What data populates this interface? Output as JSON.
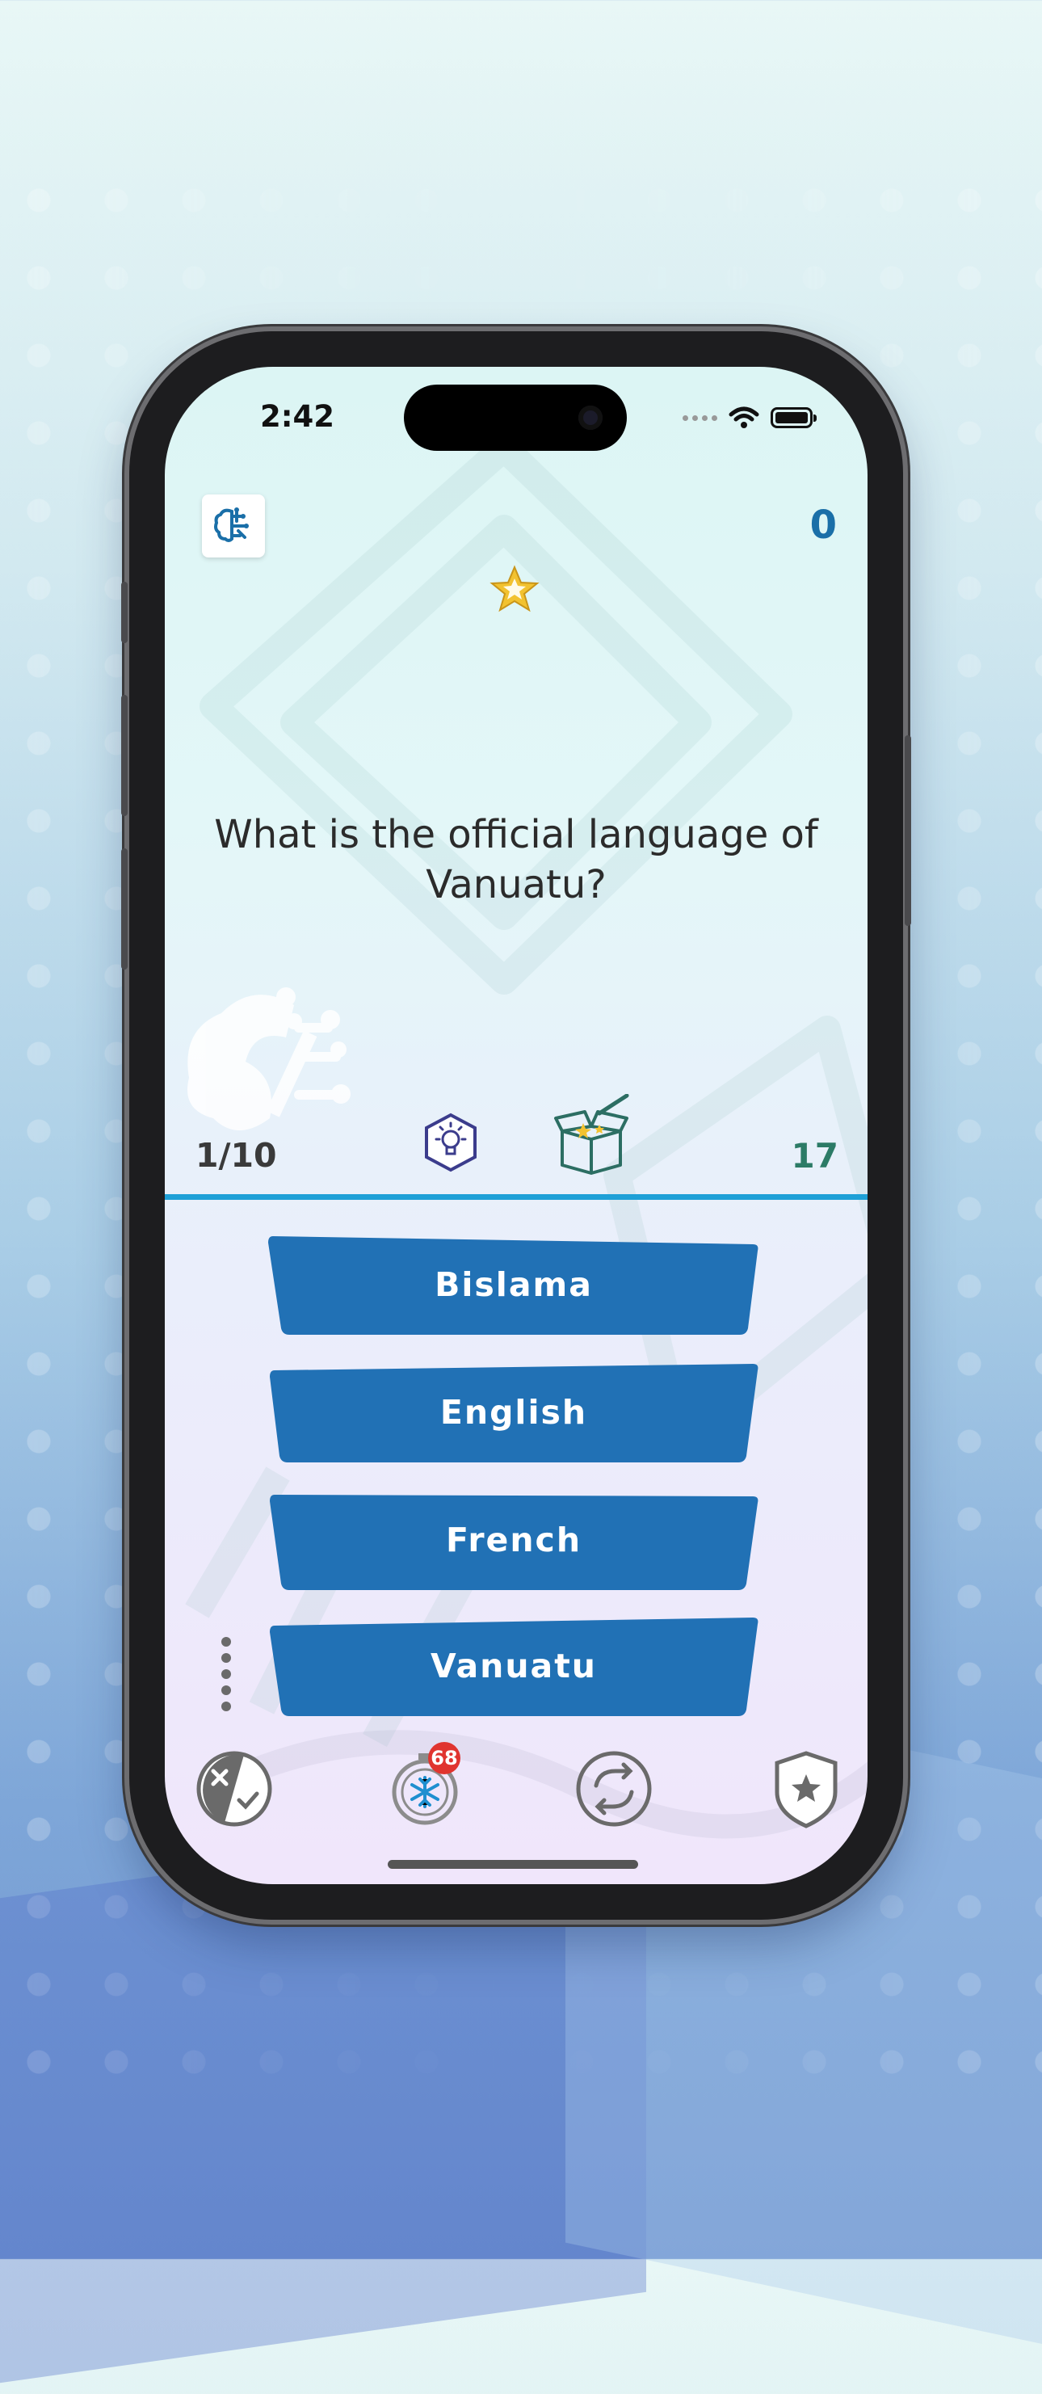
{
  "status_bar": {
    "time": "2:42"
  },
  "header": {
    "score": "0",
    "menu_icon": "brain-icon",
    "star_icon": "star-icon"
  },
  "question": {
    "text": "What is the official language of Vanuatu?"
  },
  "info_bar": {
    "progress": "1/10",
    "timer": "17",
    "hint_icon": "lightbulb-hexagon-icon",
    "box_icon": "magic-box-icon"
  },
  "answers": [
    {
      "label": "Bislama"
    },
    {
      "label": "English"
    },
    {
      "label": "French"
    },
    {
      "label": "Vanuatu"
    }
  ],
  "toolbar": {
    "fifty_fifty_icon": "fifty-fifty-icon",
    "freeze_icon": "freeze-timer-icon",
    "freeze_count": "68",
    "swap_icon": "swap-question-icon",
    "shield_icon": "shield-star-icon"
  },
  "colors": {
    "answer_button": "#2171b5",
    "score": "#1a6fa8",
    "timer": "#2c7b66",
    "divider": "#1ea0d7",
    "badge": "#e0342f"
  }
}
